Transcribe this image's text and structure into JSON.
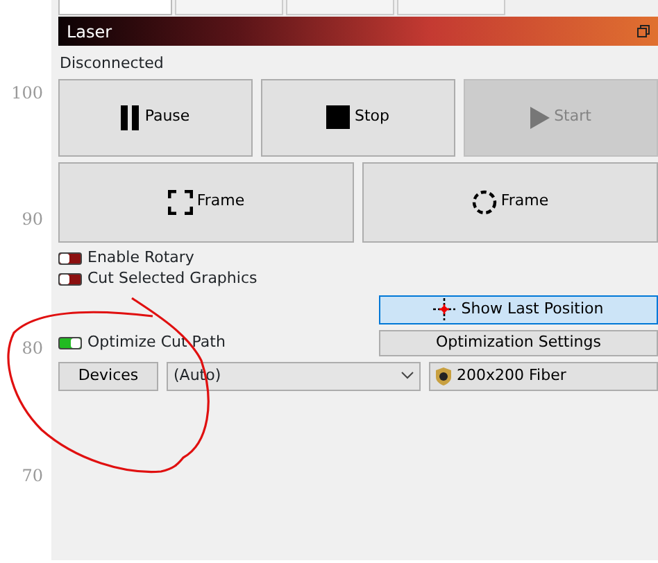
{
  "ruler": [
    "100",
    "90",
    "80",
    "70"
  ],
  "tabs": [
    {
      "selected": true
    },
    {
      "selected": false
    },
    {
      "selected": false
    },
    {
      "selected": false
    }
  ],
  "panel": {
    "title": "Laser"
  },
  "status": "Disconnected",
  "controls": [
    {
      "kind": "pause",
      "label": "Pause",
      "disabled": false
    },
    {
      "kind": "stop",
      "label": "Stop",
      "disabled": false
    },
    {
      "kind": "start",
      "label": "Start",
      "disabled": true
    }
  ],
  "frames": [
    {
      "kind": "square",
      "label": "Frame"
    },
    {
      "kind": "circle",
      "label": "Frame"
    }
  ],
  "toggles": [
    {
      "label": "Enable Rotary",
      "on": false
    },
    {
      "label": "Cut Selected Graphics",
      "on": false
    }
  ],
  "show_last_position": {
    "label": "Show Last Position"
  },
  "optimize": {
    "label": "Optimize Cut Path",
    "on": true
  },
  "optimization_settings": {
    "label": "Optimization Settings"
  },
  "devices_button": {
    "label": "Devices"
  },
  "device_select": {
    "value": "(Auto)"
  },
  "device": {
    "label": "200x200 Fiber"
  }
}
